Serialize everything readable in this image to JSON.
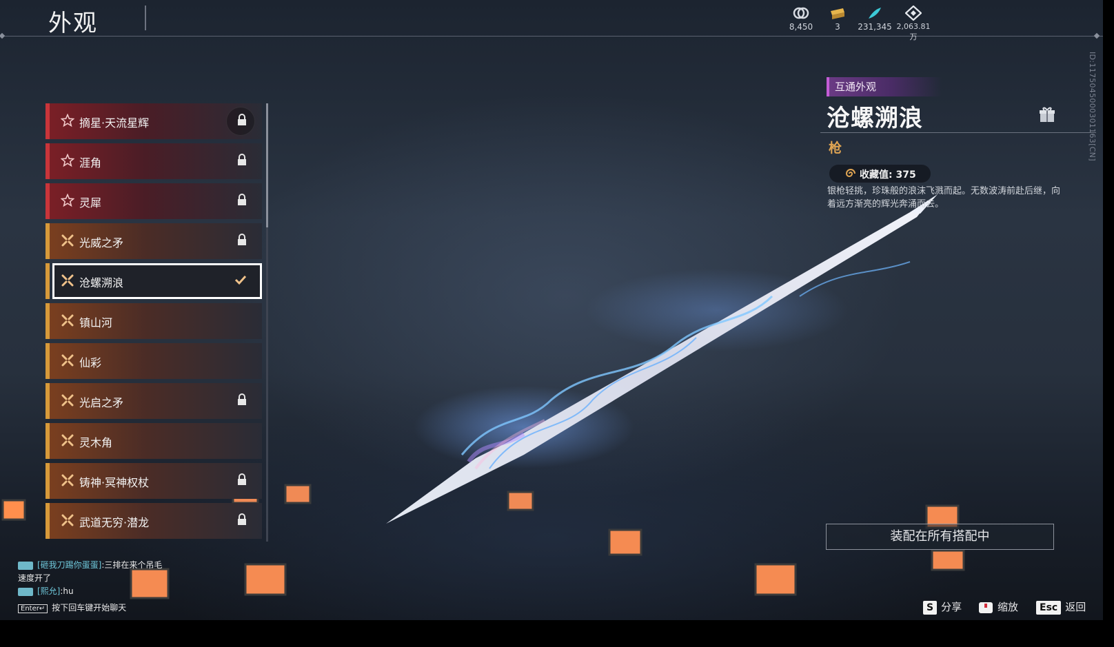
{
  "header": {
    "title": "外观"
  },
  "currencies": [
    {
      "icon": "coin-icon",
      "value": "8,450"
    },
    {
      "icon": "ticket-icon",
      "value": "3"
    },
    {
      "icon": "feather-icon",
      "value": "231,345"
    },
    {
      "icon": "diamond-icon",
      "value": "2,063.81万"
    }
  ],
  "vertical_id": "ID:1175045000301163[CN]",
  "list": {
    "items": [
      {
        "label": "摘星·天流星辉",
        "rarity": "red",
        "icon": "star-icon",
        "locked": true,
        "lock_style": "circle"
      },
      {
        "label": "涯角",
        "rarity": "red",
        "icon": "star-icon",
        "locked": true
      },
      {
        "label": "灵犀",
        "rarity": "red",
        "icon": "star-icon",
        "locked": true
      },
      {
        "label": "光威之矛",
        "rarity": "gold",
        "icon": "cross-icon",
        "locked": true
      },
      {
        "label": "沧螺溯浪",
        "rarity": "gold",
        "icon": "cross-icon",
        "locked": false,
        "selected": true
      },
      {
        "label": "镇山河",
        "rarity": "gold",
        "icon": "cross-icon",
        "locked": false
      },
      {
        "label": "仙彩",
        "rarity": "gold",
        "icon": "cross-icon",
        "locked": false
      },
      {
        "label": "光启之矛",
        "rarity": "gold",
        "icon": "cross-icon",
        "locked": true
      },
      {
        "label": "灵木角",
        "rarity": "gold",
        "icon": "cross-icon",
        "locked": false
      },
      {
        "label": "铸神·冥神权杖",
        "rarity": "gold",
        "icon": "cross-icon",
        "locked": true
      },
      {
        "label": "武道无穷·潜龙",
        "rarity": "gold",
        "icon": "cross-icon",
        "locked": true
      }
    ]
  },
  "detail": {
    "tag": "互通外观",
    "name": "沧螺溯浪",
    "type": "枪",
    "collect_label": "收藏值: 375",
    "description": "银枪轻挑，珍珠般的浪沫飞溅而起。无数波涛前赴后继，向着远方渐亮的辉光奔涌而去。",
    "equip_button": "装配在所有搭配中"
  },
  "chat": {
    "messages": [
      {
        "sender": "[砸我刀踢你蛋蛋]",
        "text": ":三排在来个吊毛"
      },
      {
        "sender": "",
        "text": "速度开了"
      },
      {
        "sender": "[熙允]",
        "text": ":hu"
      }
    ],
    "enter_key": "Enter↵",
    "hint": "按下回车键开始聊天"
  },
  "hotkeys": [
    {
      "key": "S",
      "label": "分享"
    },
    {
      "key_icon": "mouse-icon",
      "label": "缩放"
    },
    {
      "key": "Esc",
      "label": "返回"
    }
  ],
  "colors": {
    "rarity_red": "#c9353a",
    "rarity_gold": "#d79a3a",
    "accent_purple": "#c45cd6",
    "type_gold": "#e0a553"
  }
}
